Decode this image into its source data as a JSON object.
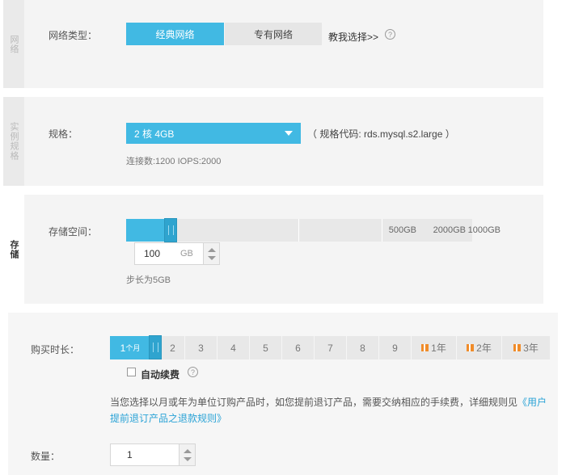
{
  "network": {
    "tab": "网络",
    "label": "网络类型：",
    "options": [
      "经典网络",
      "专有网络"
    ],
    "selected": "经典网络",
    "help_link": "教我选择>>",
    "help_icon": "?"
  },
  "spec": {
    "tab": "实例规格",
    "label": "规格：",
    "selected": "2 核 4GB",
    "code_text": "（ 规格代码: rds.mysql.s2.large ）",
    "detail": "连接数:1200 IOPS:2000"
  },
  "storage": {
    "tab": "存储",
    "label": "存储空间：",
    "ticks": [
      "500GB",
      "1000GB",
      "2000GB"
    ],
    "value": "100",
    "unit": "GB",
    "step_note": "步长为5GB",
    "fill_fraction": 0.05
  },
  "purchase": {
    "duration_label": "购买时长：",
    "first_option_main": "1",
    "first_option_small": "个月",
    "options": [
      "2",
      "3",
      "4",
      "5",
      "6",
      "7",
      "8",
      "9"
    ],
    "year_options": [
      "1年",
      "2年",
      "3年"
    ],
    "auto_renew_label": "自动续费",
    "auto_renew_checked": false,
    "notice_text": "当您选择以月或年为单位订购产品时，如您提前退订产品，需要交纳相应的手续费，详细规则见",
    "notice_link": "《用户提前退订产品之退款规则》",
    "quantity_label": "数量：",
    "quantity_value": "1"
  },
  "colors": {
    "accent": "#41b9e3",
    "gift": "#f08c2a",
    "link": "#2aa3d6"
  }
}
